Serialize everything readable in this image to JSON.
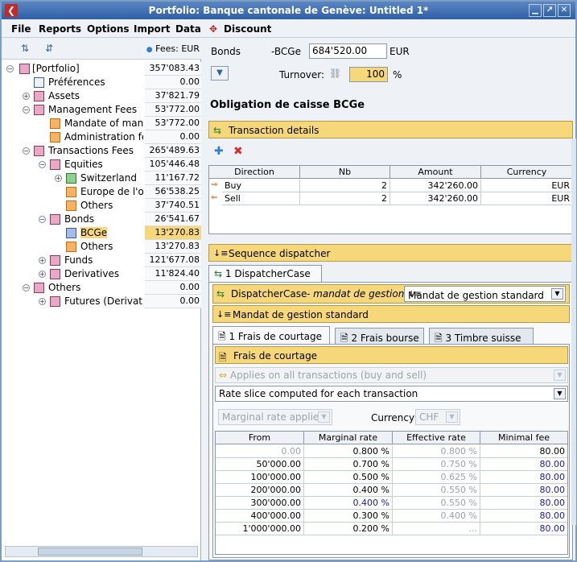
{
  "window": {
    "title": "Portfolio: Banque cantonale de Genève: Untitled 1*"
  },
  "menu": {
    "file": "File",
    "reports": "Reports",
    "options": "Options",
    "import": "Import",
    "data": "Data",
    "discount": "Discount"
  },
  "tree": {
    "fees_header": "Fees: EUR",
    "rows": [
      {
        "label": "[Portfolio]",
        "value": "357'083.43"
      },
      {
        "label": "Préférences",
        "value": "0.00"
      },
      {
        "label": "Assets",
        "value": "37'821.79"
      },
      {
        "label": "Management Fees",
        "value": "53'772.00"
      },
      {
        "label": "Mandate of managem",
        "value": "53'772.00"
      },
      {
        "label": "Administration fee",
        "value": "0.00"
      },
      {
        "label": "Transactions Fees",
        "value": "265'489.63"
      },
      {
        "label": "Equities",
        "value": "105'446.48"
      },
      {
        "label": "Switzerland",
        "value": "11'167.72"
      },
      {
        "label": "Europe de l'ou",
        "value": "56'538.25"
      },
      {
        "label": "Others",
        "value": "37'740.51"
      },
      {
        "label": "Bonds",
        "value": "26'541.67"
      },
      {
        "label": "BCGe",
        "value": "13'270.83"
      },
      {
        "label": "Others",
        "value": "13'270.83"
      },
      {
        "label": "Funds",
        "value": "121'677.08"
      },
      {
        "label": "Derivatives",
        "value": "11'824.40"
      },
      {
        "label": "Others",
        "value": "0.00"
      },
      {
        "label": "Futures (Derivative",
        "value": "0.00"
      }
    ]
  },
  "header": {
    "bonds_label": "Bonds",
    "code_label": "-BCGe",
    "amount": "684'520.00",
    "currency": "EUR",
    "turnover_label": "Turnover:",
    "turnover_value": "100",
    "percent": "%"
  },
  "main": {
    "title": "Obligation de caisse BCGe",
    "transaction_details": "Transaction details",
    "tx_headers": [
      "Direction",
      "Nb",
      "Amount",
      "Currency"
    ],
    "tx_rows": [
      {
        "direction": "Buy",
        "nb": "2",
        "amount": "342'260.00",
        "currency": "EUR"
      },
      {
        "direction": "Sell",
        "nb": "2",
        "amount": "342'260.00",
        "currency": "EUR"
      }
    ],
    "sequence_dispatcher": "Sequence dispatcher",
    "dispatcher_tab": "1 DispatcherCase",
    "dispatcher_case": "DispatcherCase",
    "dispatcher_mandat": "- mandat de gestion :",
    "dispatcher_select": "Mandat de gestion standard",
    "mandat_header": "Mandat de gestion standard",
    "tabs": [
      "1 Frais de courtage",
      "2 Frais bourse",
      "3 Timbre suisse"
    ],
    "frais_header": "Frais de courtage",
    "applies": "Applies on all transactions (buy and sell)",
    "rate_slice": "Rate slice computed for each transaction",
    "marginal_applies": "Marginal rate applies",
    "currency_label": "Currency",
    "currency_value": "CHF",
    "rate_headers": [
      "From",
      "Marginal rate",
      "Effective rate",
      "Minimal fee"
    ],
    "rate_rows": [
      {
        "from": "0.00",
        "marginal": "0.800 %",
        "effective": "0.800 %",
        "minfee": "80.00"
      },
      {
        "from": "50'000.00",
        "marginal": "0.700 %",
        "effective": "0.750 %",
        "minfee": "80.00"
      },
      {
        "from": "100'000.00",
        "marginal": "0.500 %",
        "effective": "0.625 %",
        "minfee": "80.00"
      },
      {
        "from": "200'000.00",
        "marginal": "0.400 %",
        "effective": "0.550 %",
        "minfee": "80.00"
      },
      {
        "from": "300'000.00",
        "marginal": "0.400 %",
        "effective": "0.550 %",
        "minfee": "80.00"
      },
      {
        "from": "400'000.00",
        "marginal": "0.300 %",
        "effective": "0.400 %",
        "minfee": "80.00"
      },
      {
        "from": "1'000'000.00",
        "marginal": "0.200 %",
        "effective": "...",
        "minfee": "80.00"
      }
    ]
  },
  "colors": {
    "accent": "#f6d77a",
    "title": "#2e5fa6",
    "link_blue": "#1a1aa8"
  }
}
